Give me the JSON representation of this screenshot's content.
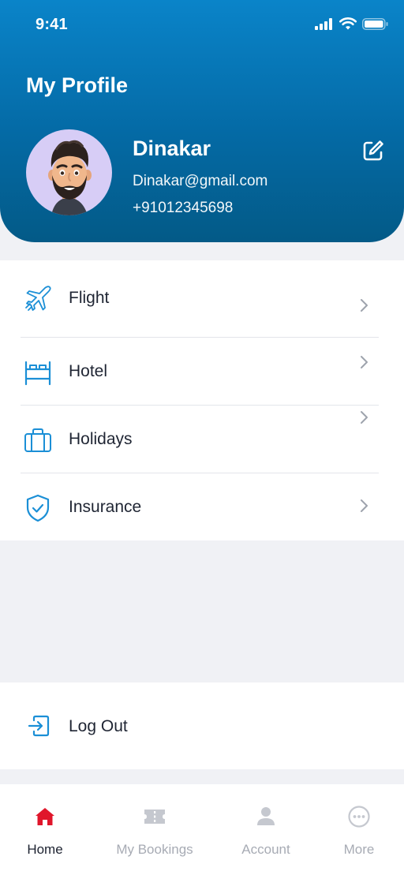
{
  "status_bar": {
    "time": "9:41"
  },
  "header": {
    "title": "My Profile"
  },
  "profile": {
    "name": "Dinakar",
    "email": "Dinakar@gmail.com",
    "phone": "+91012345698"
  },
  "menu": {
    "items": [
      {
        "label": "Flight",
        "icon": "airplane-icon"
      },
      {
        "label": "Hotel",
        "icon": "bed-icon"
      },
      {
        "label": "Holidays",
        "icon": "suitcase-icon"
      },
      {
        "label": "Insurance",
        "icon": "shield-check-icon"
      }
    ]
  },
  "logout": {
    "label": "Log Out",
    "icon": "logout-icon"
  },
  "tabbar": {
    "tabs": [
      {
        "label": "Home",
        "icon": "home-icon",
        "active": true
      },
      {
        "label": "My Bookings",
        "icon": "ticket-icon",
        "active": false
      },
      {
        "label": "Account",
        "icon": "user-icon",
        "active": false
      },
      {
        "label": "More",
        "icon": "more-icon",
        "active": false
      }
    ]
  },
  "colors": {
    "header_gradient_top": "#0a84c9",
    "header_gradient_bottom": "#035a87",
    "icon_blue": "#1b8fd6",
    "active_tab": "#e0162b",
    "inactive_tab": "#a7abb4",
    "background": "#f0f1f5"
  }
}
